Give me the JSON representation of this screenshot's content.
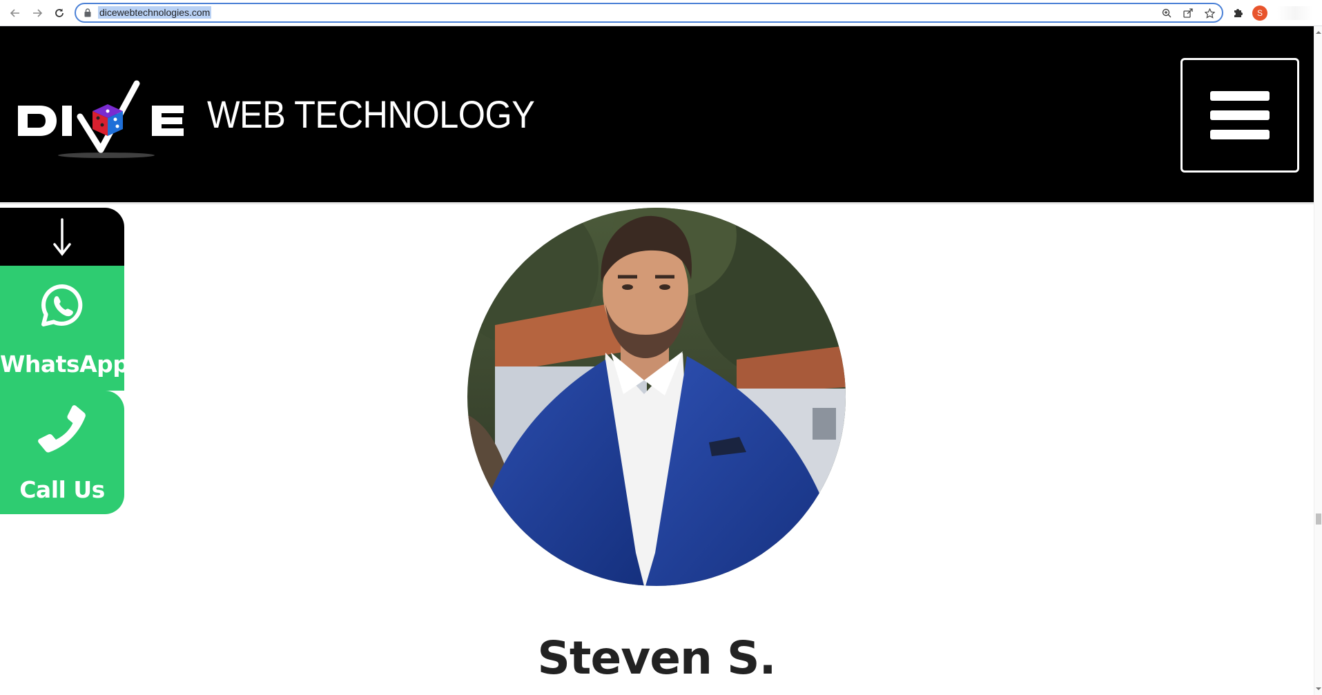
{
  "browser": {
    "url": "dicewebtechnologies.com",
    "profile_initial": "S",
    "icons": {
      "back": "arrow-left-icon",
      "forward": "arrow-right-icon",
      "reload": "reload-icon",
      "lock": "lock-icon",
      "zoom": "zoom-icon",
      "share": "share-icon",
      "bookmark": "star-icon",
      "extensions": "puzzle-icon"
    }
  },
  "header": {
    "logo_text": "WEB TECHNOLOGY",
    "logo_mark": "DICE",
    "background": "#000000"
  },
  "floating_contact": {
    "arrow_icon": "arrow-down-icon",
    "whatsapp_label": "WhatsApp",
    "call_label": "Call Us",
    "accent": "#2ecc71"
  },
  "profile": {
    "name": "Steven S."
  }
}
